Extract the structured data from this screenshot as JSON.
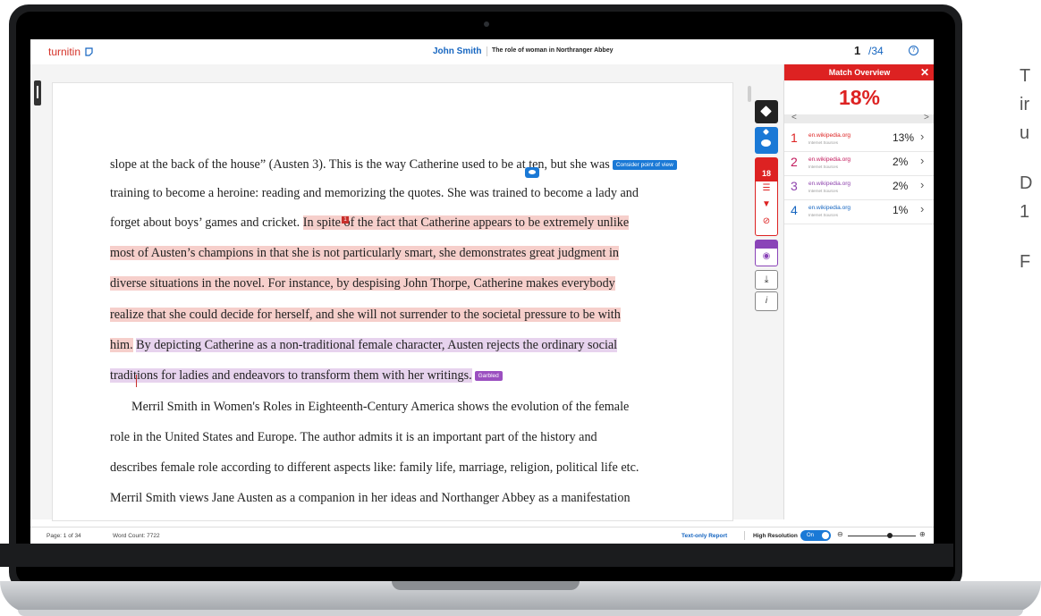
{
  "header": {
    "logo": "turnitin",
    "author": "John Smith",
    "doc_title": "The role of woman in Northranger Abbey",
    "page_current": "1",
    "page_total": "/34",
    "help": "?"
  },
  "document": {
    "line1": "slope at the back of the house” (Austen 3). This is the way Catherine used to be at ten, but she was",
    "tag_consider": "Consider point of view",
    "line2": "training to become a heroine: reading and memorizing the quotes. She was trained to become a lady and",
    "line3_plain": "forget about boys’ games and cricket.",
    "line3_hl": "In spite of the fact that Catherine appears to be extremely unlike",
    "match_marker": "1",
    "line4": "most of Austen’s champions in that she is not particularly smart, she demonstrates great judgment in",
    "line5": "diverse situations in the novel. For instance, by despising John Thorpe, Catherine makes everybody",
    "line6": "realize that she could decide for herself, and she will not surrender to the societal pressure to be with",
    "line7_red": "him.",
    "line7_purple": "By depicting Catherine as a non-traditional female character, Austen rejects the ordinary social",
    "line8": "traditions for ladies and endeavors to transform them with her writings.",
    "tag_garbled": "Garbled",
    "line9": "Merril Smith in Women's Roles in Eighteenth-Century America shows the evolution of the female",
    "line10": "role in the United States and Europe. The author admits it is an important part of the history and",
    "line11": "describes female role according to different aspects like: family life, marriage, religion, political life etc.",
    "line12": "Merril Smith views Jane Austen as a companion in her ideas and Northanger Abbey as a manifestation"
  },
  "toolbar": {
    "similarity_count": "18",
    "download": "⤓",
    "info": "i"
  },
  "panel": {
    "title": "Match Overview",
    "close": "✕",
    "score": "18%",
    "prev": "<",
    "next": ">",
    "sources": [
      {
        "num": "1",
        "name": "en.wikipedia.org",
        "type": "Internet Sources",
        "pct": "13%",
        "color": "#d22"
      },
      {
        "num": "2",
        "name": "en.wikipedia.org",
        "type": "Internet Sources",
        "pct": "2%",
        "color": "#c2185b"
      },
      {
        "num": "3",
        "name": "en.wikipedia.org",
        "type": "Internet Sources",
        "pct": "2%",
        "color": "#8e44ad"
      },
      {
        "num": "4",
        "name": "en.wikipedia.org",
        "type": "Internet Sources",
        "pct": "1%",
        "color": "#1565c0"
      }
    ]
  },
  "statusbar": {
    "page": "Page: 1 of 34",
    "words": "Word Count: 7722",
    "text_only": "Text-only Report",
    "high_res": "High Resolution",
    "toggle": "On",
    "zoom_out": "⊖",
    "zoom_in": "⊕"
  },
  "side_text": {
    "t1": "T",
    "t2": "ir",
    "t3": "u",
    "t4": "D",
    "t5": "1",
    "t6": "F"
  },
  "colors": {
    "brand_red": "#d22",
    "link_blue": "#1565c0"
  }
}
